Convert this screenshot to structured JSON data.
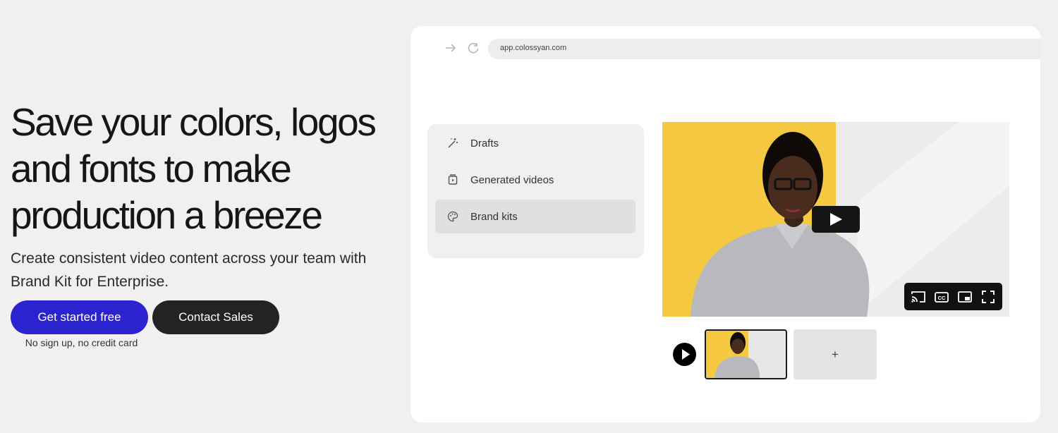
{
  "hero": {
    "title": "Save your colors, logos and fonts to make production a breeze",
    "subtitle": "Create consistent video content across your team with Brand Kit for Enterprise.",
    "primary_button": "Get started free",
    "secondary_button": "Contact Sales",
    "fine_print": "No sign up, no credit card"
  },
  "browser": {
    "url": "app.colossyan.com",
    "icons": [
      "forward-arrow-icon",
      "reload-icon"
    ]
  },
  "sidebar": {
    "items": [
      {
        "label": "Drafts",
        "icon": "wand-icon",
        "active": false
      },
      {
        "label": "Generated videos",
        "icon": "video-file-icon",
        "active": false
      },
      {
        "label": "Brand kits",
        "icon": "palette-icon",
        "active": true
      }
    ]
  },
  "player": {
    "controls": [
      "cast-icon",
      "captions-icon",
      "picture-in-picture-icon",
      "fullscreen-icon"
    ]
  },
  "timeline": {
    "add_label": "+"
  },
  "colors": {
    "primary": "#2b22d0",
    "secondary": "#232323",
    "accent_yellow": "#f5c842",
    "background": "#f1eff0"
  }
}
